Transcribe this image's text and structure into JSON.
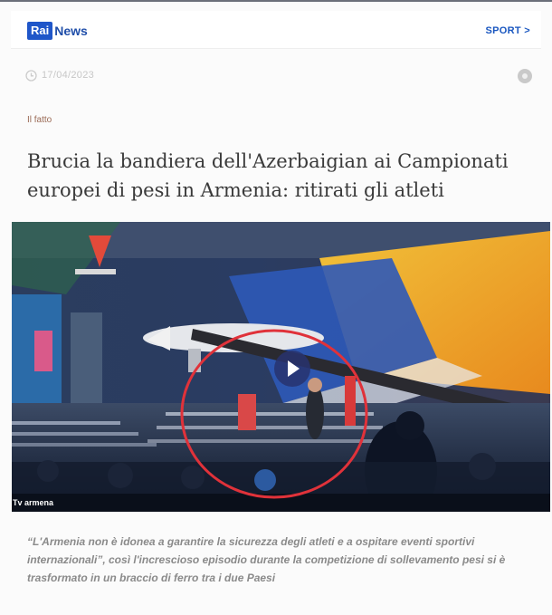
{
  "header": {
    "logo_rai": "Rai",
    "logo_news": "News",
    "section_link": "SPORT >"
  },
  "article": {
    "date": "17/04/2023",
    "kicker": "Il fatto",
    "headline": "Brucia la bandiera dell'Azerbaigian ai Campionati europei di pesi in Armenia: ritirati gli atleti",
    "video_source": "Tv armena",
    "summary": "“L'Armenia non è idonea a garantire la sicurezza degli atleti e a ospitare eventi sportivi internazionali”, così l'increscioso episodio durante la competizione di sollevamento pesi si è trasformato in un braccio di ferro tra i due Paesi"
  },
  "icons": {
    "clock": "clock-icon",
    "share": "share-icon",
    "play": "play-icon"
  },
  "colors": {
    "brand_blue": "#1f56c9",
    "highlight_circle": "#e0323a"
  }
}
